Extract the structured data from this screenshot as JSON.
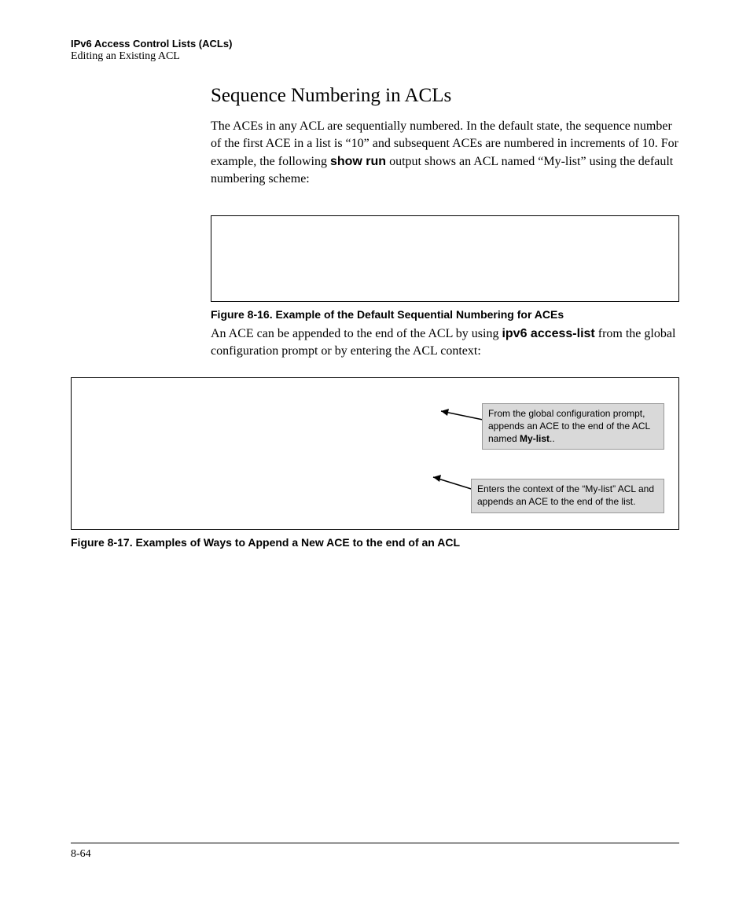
{
  "header": {
    "chapter": "IPv6 Access Control Lists (ACLs)",
    "section": "Editing an Existing ACL"
  },
  "title": "Sequence Numbering in ACLs",
  "para1_a": "The ACEs in any ACL are sequentially numbered. In the default state, the sequence number of the first ACE in a list is “10” and subsequent ACEs are numbered in increments of 10. For example, the following ",
  "para1_bold": "show run",
  "para1_b": " output shows an ACL named “My-list” using the default numbering scheme:",
  "figure16_caption": "Figure 8-16. Example of the Default Sequential Numbering for ACEs",
  "para2_a": "An ACE can be appended to the end of the ACL by using ",
  "para2_bold": "ipv6 access-list",
  "para2_b": " from the global configuration prompt or by entering the ACL context:",
  "callout1_a": "From the global configuration prompt, appends an ACE to the end of the ACL named ",
  "callout1_bold": "My-list",
  "callout1_b": "..",
  "callout2": "Enters the context of the “My-list” ACL and appends an ACE to the end of the list.",
  "figure17_caption": "Figure 8-17. Examples of Ways to Append a New ACE to the end of an ACL",
  "page_number": "8-64"
}
